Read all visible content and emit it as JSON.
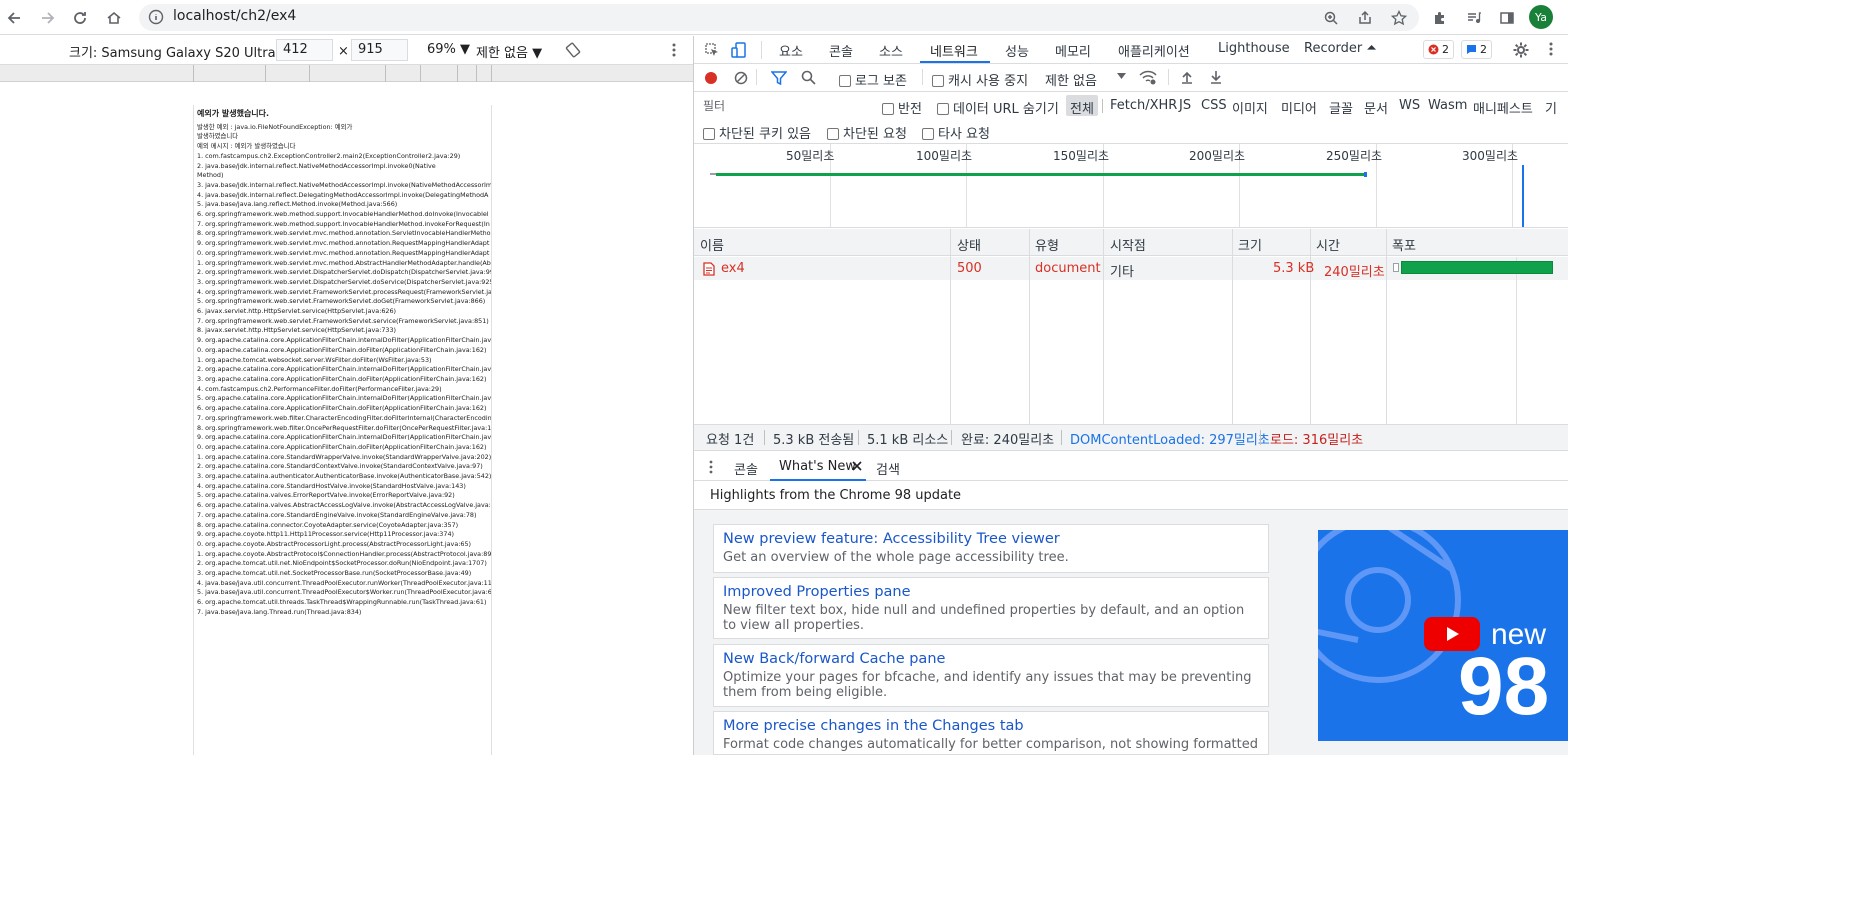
{
  "browser": {
    "url": "localhost/ch2/ex4",
    "profile_initials": "Ya"
  },
  "device_toolbar": {
    "device_label": "크기: Samsung Galaxy S20 Ultra ▼",
    "width": "412",
    "times": "×",
    "height": "915",
    "zoom": "69% ▼",
    "throttle": "제한 없음 ▼"
  },
  "error_page": {
    "title": "예외가 발생했습니다.",
    "intro_lines": [
      "발생한 예외 : java.io.FileNotFoundException: 예외가",
      "발생하였습니다",
      "예외 메시지 : 예외가 발생하였습니다"
    ],
    "stack": [
      "1. com.fastcampus.ch2.ExceptionController2.main2(ExceptionController2.java:29)",
      "2. java.base/jdk.internal.reflect.NativeMethodAccessorImpl.invoke0(Native",
      "   Method)",
      "3. java.base/jdk.internal.reflect.NativeMethodAccessorImpl.invoke(NativeMethodAccessorIm",
      "4. java.base/jdk.internal.reflect.DelegatingMethodAccessorImpl.invoke(DelegatingMethodA",
      "5. java.base/java.lang.reflect.Method.invoke(Method.java:566)",
      "6. org.springframework.web.method.support.InvocableHandlerMethod.doInvoke(Invocablel",
      "7. org.springframework.web.method.support.InvocableHandlerMethod.invokeForRequest(In",
      "8. org.springframework.web.servlet.mvc.method.annotation.ServletInvocableHandlerMetho",
      "9. org.springframework.web.servlet.mvc.method.annotation.RequestMappingHandlerAdapt",
      "0. org.springframework.web.servlet.mvc.method.annotation.RequestMappingHandlerAdapt",
      "1. org.springframework.web.servlet.mvc.method.AbstractHandlerMethodAdapter.handle(Ab",
      "2. org.springframework.web.servlet.DispatcherServlet.doDispatch(DispatcherServlet.java:99",
      "3. org.springframework.web.servlet.DispatcherServlet.doService(DispatcherServlet.java:925)",
      "4. org.springframework.web.servlet.FrameworkServlet.processRequest(FrameworkServlet.jav",
      "5. org.springframework.web.servlet.FrameworkServlet.doGet(FrameworkServlet.java:866)",
      "6. javax.servlet.http.HttpServlet.service(HttpServlet.java:626)",
      "7. org.springframework.web.servlet.FrameworkServlet.service(FrameworkServlet.java:851)",
      "8. javax.servlet.http.HttpServlet.service(HttpServlet.java:733)",
      "9. org.apache.catalina.core.ApplicationFilterChain.internalDoFilter(ApplicationFilterChain.jav",
      "0. org.apache.catalina.core.ApplicationFilterChain.doFilter(ApplicationFilterChain.java:162)",
      "1. org.apache.tomcat.websocket.server.WsFilter.doFilter(WsFilter.java:53)",
      "2. org.apache.catalina.core.ApplicationFilterChain.internalDoFilter(ApplicationFilterChain.jav",
      "3. org.apache.catalina.core.ApplicationFilterChain.doFilter(ApplicationFilterChain.java:162)",
      "4. com.fastcampus.ch2.PerformanceFilter.doFilter(PerformanceFilter.java:29)",
      "5. org.apache.catalina.core.ApplicationFilterChain.internalDoFilter(ApplicationFilterChain.jav",
      "6. org.apache.catalina.core.ApplicationFilterChain.doFilter(ApplicationFilterChain.java:162)",
      "7. org.springframework.web.filter.CharacterEncodingFilter.doFilterInternal(CharacterEncodin",
      "8. org.springframework.web.filter.OncePerRequestFilter.doFilter(OncePerRequestFilter.java:1",
      "9. org.apache.catalina.core.ApplicationFilterChain.internalDoFilter(ApplicationFilterChain.jav",
      "0. org.apache.catalina.core.ApplicationFilterChain.doFilter(ApplicationFilterChain.java:162)",
      "1. org.apache.catalina.core.StandardWrapperValve.invoke(StandardWrapperValve.java:202)",
      "2. org.apache.catalina.core.StandardContextValve.invoke(StandardContextValve.java:97)",
      "3. org.apache.catalina.authenticator.AuthenticatorBase.invoke(AuthenticatorBase.java:542)",
      "4. org.apache.catalina.core.StandardHostValve.invoke(StandardHostValve.java:143)",
      "5. org.apache.catalina.valves.ErrorReportValve.invoke(ErrorReportValve.java:92)",
      "6. org.apache.catalina.valves.AbstractAccessLogValve.invoke(AbstractAccessLogValve.java:68",
      "7. org.apache.catalina.core.StandardEngineValve.invoke(StandardEngineValve.java:78)",
      "8. org.apache.catalina.connector.CoyoteAdapter.service(CoyoteAdapter.java:357)",
      "9. org.apache.coyote.http11.Http11Processor.service(Http11Processor.java:374)",
      "0. org.apache.coyote.AbstractProcessorLight.process(AbstractProcessorLight.java:65)",
      "1. org.apache.coyote.AbstractProtocol$ConnectionHandler.process(AbstractProtocol.java:89",
      "2. org.apache.tomcat.util.net.NioEndpoint$SocketProcessor.doRun(NioEndpoint.java:1707)",
      "3. org.apache.tomcat.util.net.SocketProcessorBase.run(SocketProcessorBase.java:49)",
      "4. java.base/java.util.concurrent.ThreadPoolExecutor.runWorker(ThreadPoolExecutor.java:112",
      "5. java.base/java.util.concurrent.ThreadPoolExecutor$Worker.run(ThreadPoolExecutor.java:62",
      "6. org.apache.tomcat.util.threads.TaskThread$WrappingRunnable.run(TaskThread.java:61)",
      "7. java.base/java.lang.Thread.run(Thread.java:834)"
    ]
  },
  "devtools": {
    "tabs": [
      "요소",
      "콘솔",
      "소스",
      "네트워크",
      "성능",
      "메모리",
      "애플리케이션",
      "Lighthouse",
      "Recorder ⏶"
    ],
    "active_tab": "네트워크",
    "error_count": "2",
    "message_count": "2",
    "network_toolbar": {
      "preserve_log": "로그 보존",
      "disable_cache": "캐시 사용 중지",
      "throttle": "제한 없음"
    },
    "filter": {
      "placeholder": "필터",
      "invert": "반전",
      "hide_data_urls": "데이터 URL 숨기기",
      "types": [
        "전체",
        "Fetch/XHR",
        "JS",
        "CSS",
        "이미지",
        "미디어",
        "글꼴",
        "문서",
        "WS",
        "Wasm",
        "매니페스트",
        "기타"
      ],
      "blocked_cookies": "차단된 쿠키 있음",
      "blocked_requests": "차단된 요청",
      "third_party": "타사 요청"
    },
    "timeline_ticks": [
      "50밀리초",
      "100밀리초",
      "150밀리초",
      "200밀리초",
      "250밀리초",
      "300밀리초"
    ],
    "table": {
      "headers": [
        "이름",
        "상태",
        "유형",
        "시작점",
        "크기",
        "시간",
        "폭포"
      ],
      "rows": [
        {
          "name": "ex4",
          "status": "500",
          "type": "document",
          "initiator": "기타",
          "size": "5.3 kB",
          "time": "240밀리초"
        }
      ]
    },
    "summary": {
      "requests": "요청 1건",
      "transferred": "5.3 kB 전송됨",
      "resources": "5.1 kB 리소스",
      "finish": "완료: 240밀리초",
      "dcl": "DOMContentLoaded: 297밀리초",
      "load": "로드: 316밀리초"
    },
    "drawer": {
      "tabs": [
        "콘솔",
        "What's New",
        "검색"
      ],
      "active": "What's New",
      "headline": "Highlights from the Chrome 98 update",
      "cards": [
        {
          "title": "New preview feature: Accessibility Tree viewer",
          "desc": "Get an overview of the whole page accessibility tree."
        },
        {
          "title": "Improved Properties pane",
          "desc": "New filter text box, hide null and undefined properties by default, and an option to view all properties."
        },
        {
          "title": "New Back/forward Cache pane",
          "desc": "Optimize your pages for bfcache, and identify any issues that may be preventing them from being eligible."
        },
        {
          "title": "More precise changes in the Changes tab",
          "desc": "Format code changes automatically for better comparison, not showing formatted source"
        }
      ],
      "promo_text_1": "new",
      "promo_text_2": "98"
    }
  },
  "colors": {
    "accent": "#1a73e8",
    "error": "#d93025",
    "success": "#0fa14b",
    "dcl": "#1a73e8",
    "load": "#c5221f"
  }
}
